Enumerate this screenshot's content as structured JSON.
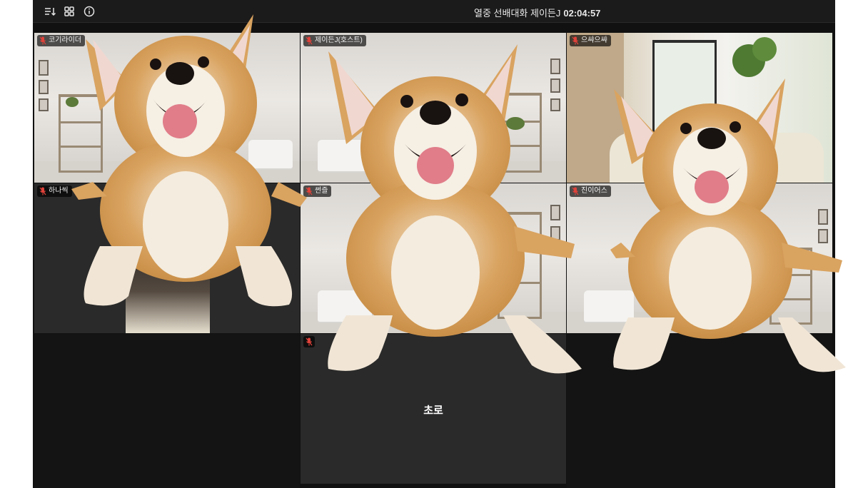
{
  "meeting": {
    "title": "열중 선배대화 제이든J",
    "elapsed": "02:04:57"
  },
  "toolbar": {
    "sort_icon": "sort-icon",
    "grid_icon": "grid-view-icon",
    "info_icon": "info-icon"
  },
  "participants": [
    {
      "name": "코기라이더",
      "muted": true
    },
    {
      "name": "제이든J(호스트)",
      "muted": true
    },
    {
      "name": "으쌰으쌰",
      "muted": true
    },
    {
      "name": "하나씩",
      "muted": true
    },
    {
      "name": "썬즐",
      "muted": true
    },
    {
      "name": "진이어스",
      "muted": true
    },
    {
      "name": "",
      "muted": true,
      "placeholder": "초로"
    }
  ],
  "colors": {
    "background": "#111111",
    "tile_dark": "#2a2a2a",
    "mic_muted": "#e0423a"
  }
}
